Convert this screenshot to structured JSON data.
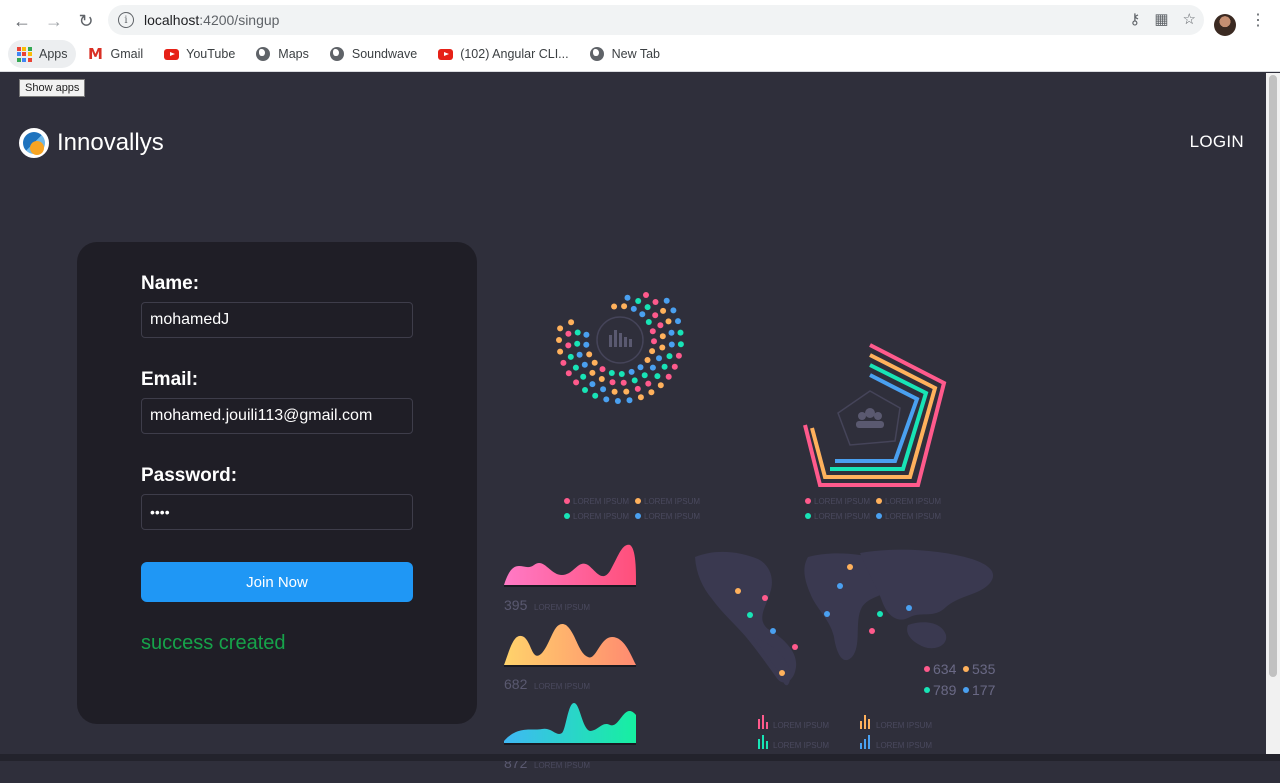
{
  "browser": {
    "url_host": "localhost",
    "url_path": ":4200/singup",
    "bookmarks": [
      {
        "label": "Apps",
        "icon": "apps-grid-icon"
      },
      {
        "label": "Gmail",
        "icon": "gmail-icon"
      },
      {
        "label": "YouTube",
        "icon": "youtube-icon"
      },
      {
        "label": "Maps",
        "icon": "globe-icon"
      },
      {
        "label": "Soundwave",
        "icon": "globe-icon"
      },
      {
        "label": "(102) Angular CLI...",
        "icon": "youtube-icon"
      },
      {
        "label": "New Tab",
        "icon": "globe-icon"
      }
    ],
    "tooltip": "Show apps"
  },
  "header": {
    "brand": "Innovallys",
    "login_label": "LOGIN"
  },
  "form": {
    "name_label": "Name:",
    "name_value": "mohamedJ",
    "email_label": "Email:",
    "email_value": "mohamed.jouili113@gmail.com",
    "password_label": "Password:",
    "password_value": "••••",
    "submit_label": "Join Now",
    "status_message": "success created",
    "status_color": "#16a34a",
    "button_color": "#1f97f5"
  },
  "infographic": {
    "legend_text": "LOREM IPSUM",
    "metrics": [
      "395",
      "682",
      "872"
    ],
    "map_stats": [
      "634",
      "535",
      "789",
      "177"
    ]
  }
}
